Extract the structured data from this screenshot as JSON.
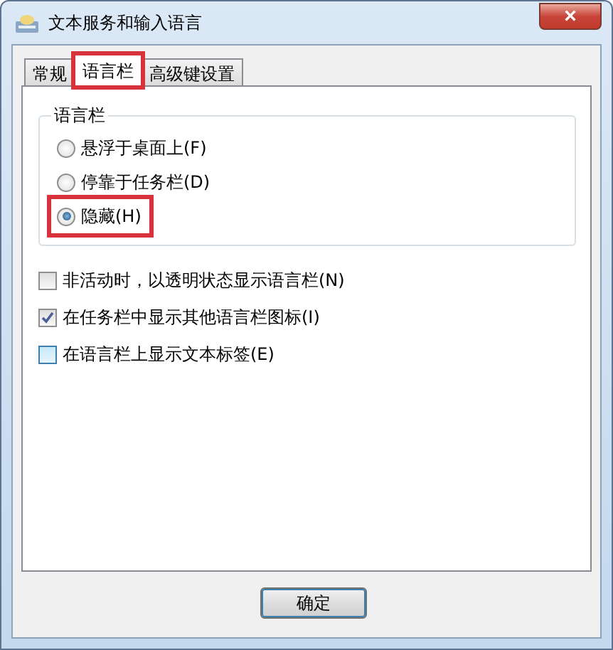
{
  "window": {
    "title": "文本服务和输入语言",
    "close": "×"
  },
  "tabs": [
    {
      "label": "常规",
      "selected": false,
      "highlighted": false
    },
    {
      "label": "语言栏",
      "selected": true,
      "highlighted": true
    },
    {
      "label": "高级键设置",
      "selected": false,
      "highlighted": false
    }
  ],
  "group": {
    "title": "语言栏",
    "options": [
      {
        "label": "悬浮于桌面上(F)",
        "selected": false,
        "highlighted": false
      },
      {
        "label": "停靠于任务栏(D)",
        "selected": false,
        "highlighted": false
      },
      {
        "label": "隐藏(H)",
        "selected": true,
        "highlighted": true
      }
    ]
  },
  "checkboxes": [
    {
      "label": "非活动时，以透明状态显示语言栏(N)",
      "checked": false,
      "hovered": false
    },
    {
      "label": "在任务栏中显示其他语言栏图标(I)",
      "checked": true,
      "hovered": false
    },
    {
      "label": "在语言栏上显示文本标签(E)",
      "checked": false,
      "hovered": true
    }
  ],
  "buttons": [
    "确定"
  ]
}
